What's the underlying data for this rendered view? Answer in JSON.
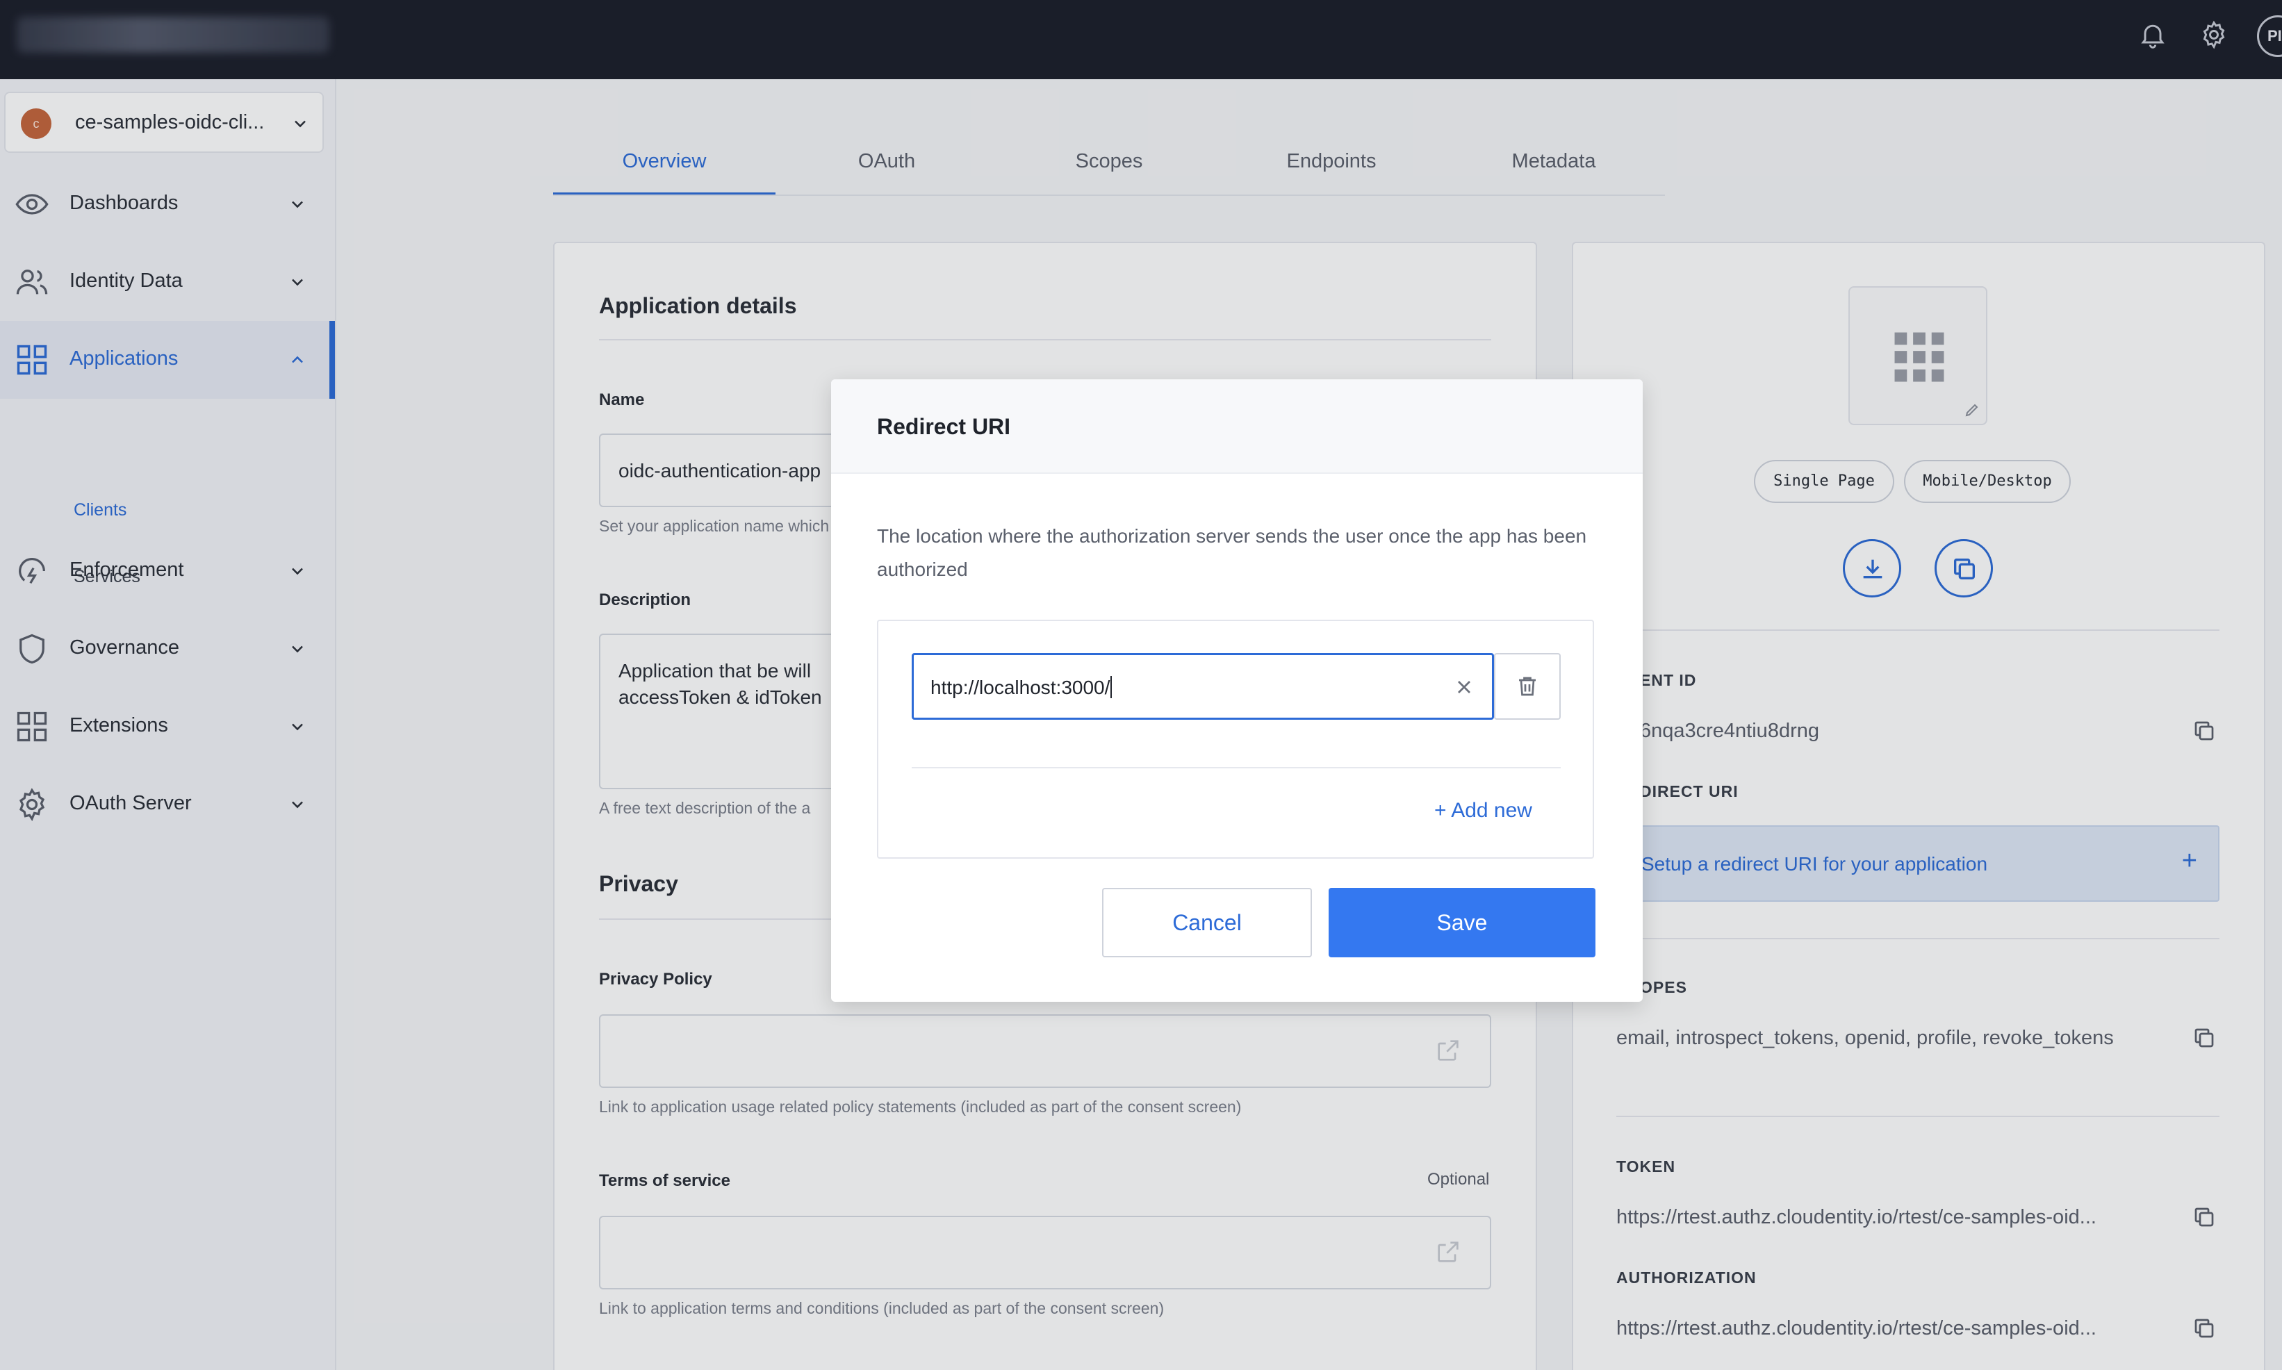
{
  "topbar": {
    "icons": [
      "bell-icon",
      "gear-icon"
    ],
    "avatar_initials": "PI"
  },
  "sidebar": {
    "workspace": {
      "initial": "c",
      "name": "ce-samples-oidc-cli..."
    },
    "items": [
      {
        "label": "Dashboards",
        "icon": "eye-icon"
      },
      {
        "label": "Identity Data",
        "icon": "users-icon"
      },
      {
        "label": "Applications",
        "icon": "grid-icon",
        "active": true
      },
      {
        "label": "Enforcement",
        "icon": "bolt-icon"
      },
      {
        "label": "Governance",
        "icon": "shield-icon"
      },
      {
        "label": "Extensions",
        "icon": "grid-icon"
      },
      {
        "label": "OAuth Server",
        "icon": "gear-icon"
      }
    ],
    "subitems": [
      {
        "label": "Clients",
        "active": true
      },
      {
        "label": "Services"
      }
    ]
  },
  "tabs": [
    {
      "label": "Overview",
      "active": true
    },
    {
      "label": "OAuth"
    },
    {
      "label": "Scopes"
    },
    {
      "label": "Endpoints"
    },
    {
      "label": "Metadata"
    }
  ],
  "details": {
    "title": "Application details",
    "name_label": "Name",
    "name_value": "oidc-authentication-app",
    "name_hint": "Set your application name which",
    "description_label": "Description",
    "description_line1": "Application that be will",
    "description_line2": "accessToken & idToken",
    "description_hint": "A free text description of the a",
    "privacy_title": "Privacy",
    "privacy_label": "Privacy Policy",
    "privacy_hint": "Link to application usage related policy statements (included as part of the consent screen)",
    "tos_label": "Terms of service",
    "tos_optional": "Optional",
    "tos_hint": "Link to application terms and conditions (included as part of the consent screen)"
  },
  "right_panel": {
    "pills": [
      "Single Page",
      "Mobile/Desktop"
    ],
    "client_id_label": "ENT ID",
    "client_id_value": "6nqa3cre4ntiu8drng",
    "redirect_label": "DIRECT URI",
    "redirect_setup": "Setup a redirect URI for your application",
    "scopes_label": "OPES",
    "scopes_value": "email, introspect_tokens, openid, profile, revoke_tokens",
    "token_label": "TOKEN",
    "token_value": "https://rtest.authz.cloudentity.io/rtest/ce-samples-oid...",
    "authorization_label": "AUTHORIZATION",
    "authorization_value": "https://rtest.authz.cloudentity.io/rtest/ce-samples-oid..."
  },
  "modal": {
    "title": "Redirect URI",
    "description": "The location where the authorization server sends the user once the app has been authorized",
    "uri_value": "http://localhost:3000/",
    "add_new": "+ Add new",
    "cancel": "Cancel",
    "save": "Save"
  },
  "colors": {
    "accent": "#2d6bd7",
    "save_button": "#3478f0",
    "topbar": "#1c1f2b"
  }
}
